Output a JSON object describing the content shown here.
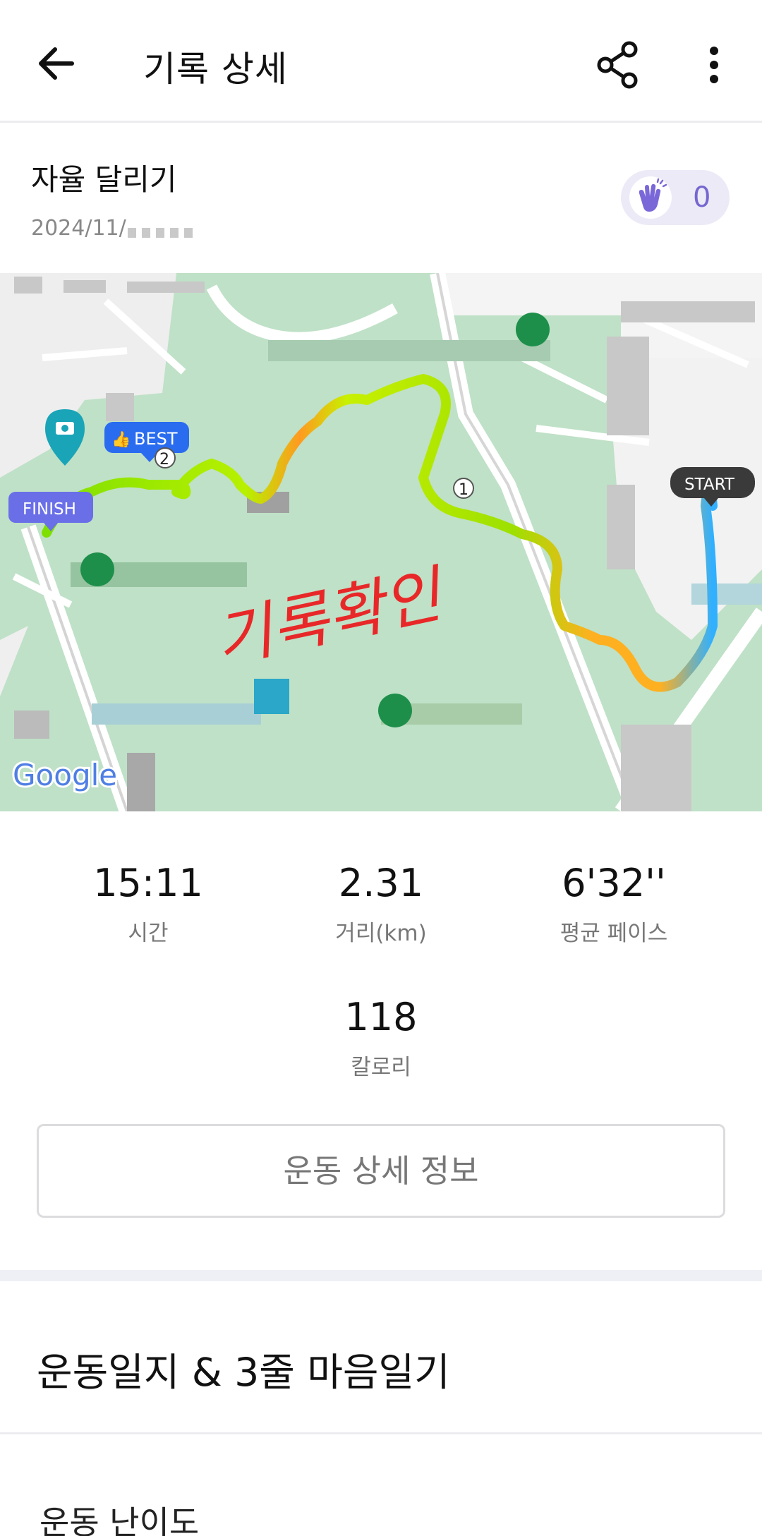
{
  "header": {
    "title": "기록 상세",
    "back_icon": "arrow-left-icon",
    "share_icon": "share-icon",
    "more_icon": "more-vertical-icon"
  },
  "record": {
    "name": "자율 달리기",
    "date": "2024/11/"
  },
  "clap": {
    "icon": "clap-icon",
    "count": "0",
    "accent": "#7566d0"
  },
  "map": {
    "labels": {
      "best": "BEST",
      "finish": "FINISH",
      "start": "START",
      "google": "Google",
      "handwriting": "기록확인"
    },
    "markers": {
      "lap1": "1",
      "lap2": "2"
    }
  },
  "stats": {
    "time": {
      "value": "15:11",
      "label": "시간"
    },
    "distance": {
      "value": "2.31",
      "label": "거리(km)"
    },
    "pace": {
      "value": "6'32''",
      "label": "평균 페이스"
    },
    "calories": {
      "value": "118",
      "label": "칼로리"
    }
  },
  "buttons": {
    "detail": "운동 상세 정보"
  },
  "journal": {
    "title": "운동일지 & 3줄 마음일기"
  },
  "difficulty": {
    "title": "운동 난이도"
  }
}
